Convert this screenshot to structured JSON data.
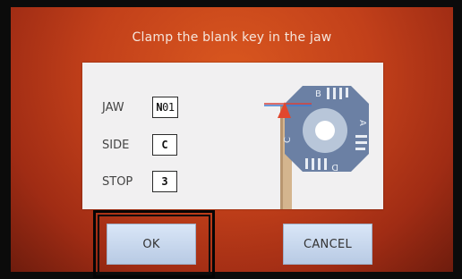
{
  "screen": {
    "instruction": "Clamp the blank key in the jaw"
  },
  "settings": {
    "jaw": {
      "label": "JAW",
      "value_bold": "N",
      "value_rest": "01"
    },
    "side": {
      "label": "SIDE",
      "value": "C"
    },
    "stop": {
      "label": "STOP",
      "value": "3"
    }
  },
  "diagram": {
    "face_labels": [
      "B",
      "A",
      "D",
      "C"
    ]
  },
  "buttons": {
    "ok_label": "OK",
    "cancel_label": "CANCEL"
  },
  "colors": {
    "background_accent": "#c2401a",
    "button_fill": "#c8d7ee",
    "jaw_body": "#6a7fa3",
    "jaw_hub": "#b7c5d8",
    "key_blank": "#d2b48c",
    "marker_red": "#e0472d",
    "marker_blue": "#3d7bd1"
  }
}
